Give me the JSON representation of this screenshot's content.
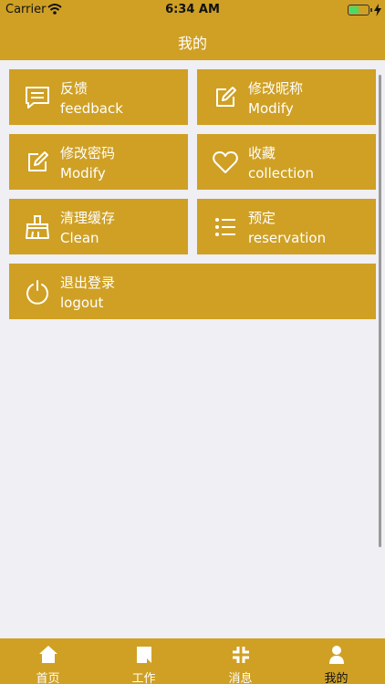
{
  "status_bar": {
    "carrier": "Carrier",
    "time": "6:34 AM",
    "battery_level": 0.5
  },
  "nav": {
    "title": "我的"
  },
  "tiles": [
    {
      "title": "反馈",
      "subtitle": "feedback",
      "icon": "chat-icon"
    },
    {
      "title": "修改昵称",
      "subtitle": "Modify",
      "icon": "edit-icon"
    },
    {
      "title": "修改密码",
      "subtitle": "Modify",
      "icon": "edit-icon"
    },
    {
      "title": "收藏",
      "subtitle": "collection",
      "icon": "heart-icon"
    },
    {
      "title": "清理缓存",
      "subtitle": "Clean",
      "icon": "broom-icon"
    },
    {
      "title": "预定",
      "subtitle": "reservation",
      "icon": "list-icon"
    },
    {
      "title": "退出登录",
      "subtitle": "logout",
      "icon": "power-icon"
    }
  ],
  "tabs": [
    {
      "label": "首页",
      "icon": "home-icon"
    },
    {
      "label": "工作",
      "icon": "work-icon"
    },
    {
      "label": "消息",
      "icon": "message-icon"
    },
    {
      "label": "我的",
      "icon": "profile-icon",
      "active": true
    }
  ],
  "colors": {
    "accent": "#cfa024",
    "background": "#efeff4",
    "active_tab_text": "#111111"
  }
}
